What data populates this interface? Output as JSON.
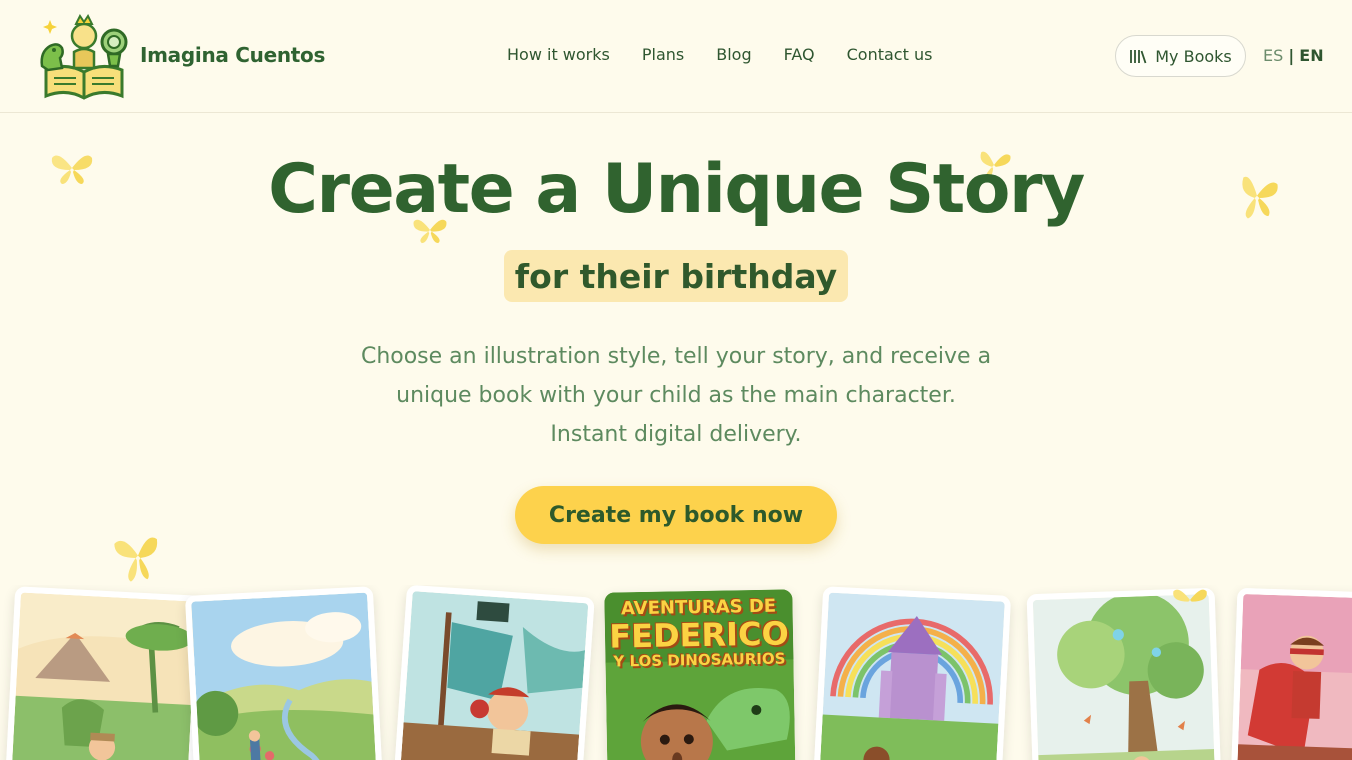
{
  "brand": {
    "name": "Imagina Cuentos",
    "logo_icon": "dinosaur-princess-book-logo-icon"
  },
  "nav": {
    "items": [
      {
        "label": "How it works"
      },
      {
        "label": "Plans"
      },
      {
        "label": "Blog"
      },
      {
        "label": "FAQ"
      },
      {
        "label": "Contact us"
      }
    ]
  },
  "actions": {
    "my_books_label": "My Books",
    "my_books_icon": "library-books-icon"
  },
  "language": {
    "es": "ES",
    "separator": "|",
    "en": "EN",
    "active": "EN"
  },
  "hero": {
    "title": "Create a Unique Story",
    "subtitle": "for their birthday",
    "description": "Choose an illustration style, tell your story, and receive a unique book with your child as the main character. Instant digital delivery.",
    "cta_label": "Create my book now"
  },
  "books": {
    "featured_cover_line1": "AVENTURAS DE",
    "featured_cover_line2": "FEDERICO",
    "featured_cover_line3": "Y LOS DINOSAURIOS"
  },
  "colors": {
    "background": "#fefbec",
    "brand_green": "#30632f",
    "accent_yellow": "#fdd24c",
    "pill_bg": "#fbe8b0",
    "text_muted": "#5d8a5f"
  }
}
